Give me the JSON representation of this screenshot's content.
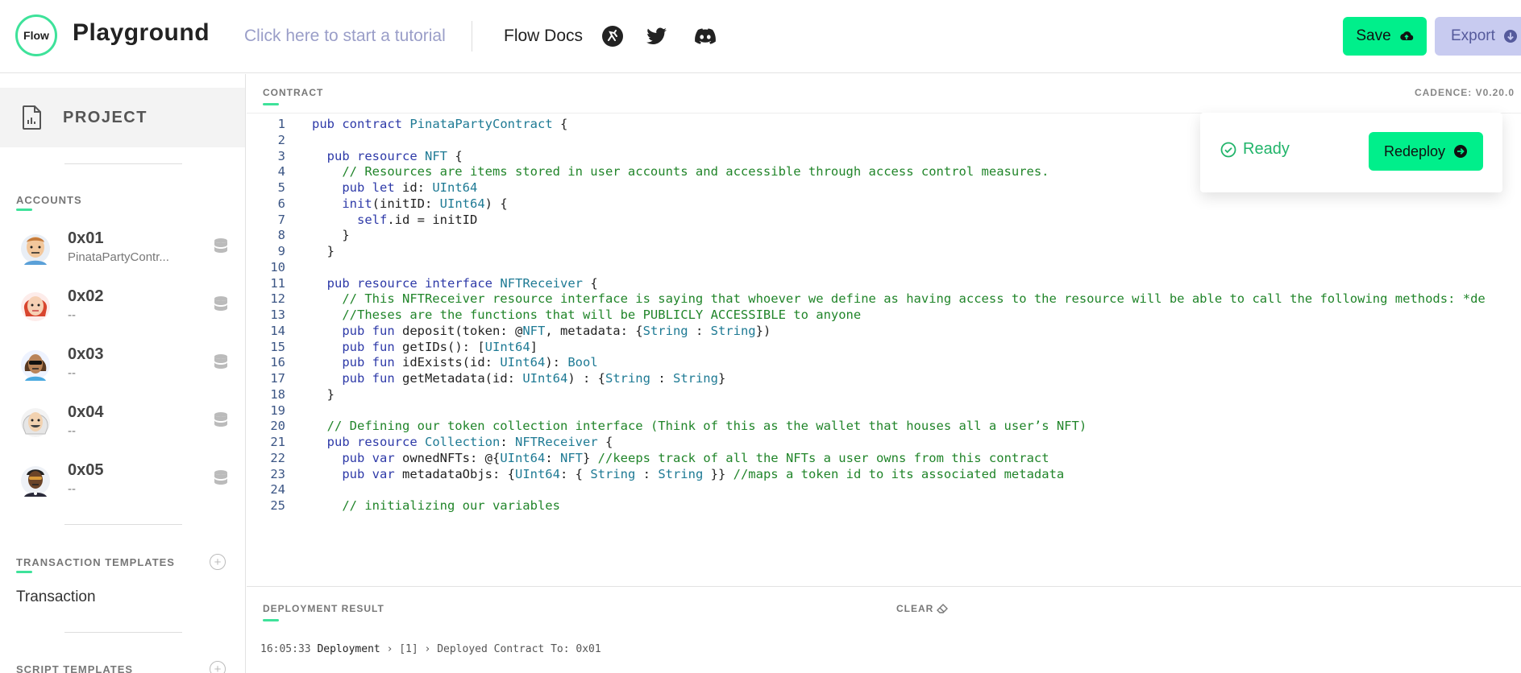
{
  "header": {
    "logo_text": "Flow",
    "title": "Playground",
    "tutorial_link": "Click here to start a tutorial",
    "docs_link": "Flow Docs",
    "icons": [
      "cadence-runner-icon",
      "twitter-icon",
      "discord-icon"
    ],
    "save_label": "Save",
    "export_label": "Export"
  },
  "sidebar": {
    "project_label": "PROJECT",
    "accounts_heading": "ACCOUNTS",
    "accounts": [
      {
        "address": "0x01",
        "subtitle": "PinataPartyContr..."
      },
      {
        "address": "0x02",
        "subtitle": "--"
      },
      {
        "address": "0x03",
        "subtitle": "--"
      },
      {
        "address": "0x04",
        "subtitle": "--"
      },
      {
        "address": "0x05",
        "subtitle": "--"
      }
    ],
    "transaction_heading": "TRANSACTION TEMPLATES",
    "transaction_items": [
      "Transaction"
    ],
    "script_heading": "SCRIPT TEMPLATES"
  },
  "editor": {
    "contract_label": "CONTRACT",
    "cadence_version": "CADENCE: V0.20.0",
    "status": "Ready",
    "redeploy_label": "Redeploy",
    "lines": [
      {
        "n": "1",
        "text": "pub contract PinataPartyContract {"
      },
      {
        "n": "2",
        "text": ""
      },
      {
        "n": "3",
        "text": "  pub resource NFT {"
      },
      {
        "n": "4",
        "text": "    // Resources are items stored in user accounts and accessible through access control measures."
      },
      {
        "n": "5",
        "text": "    pub let id: UInt64"
      },
      {
        "n": "6",
        "text": "    init(initID: UInt64) {"
      },
      {
        "n": "7",
        "text": "      self.id = initID"
      },
      {
        "n": "8",
        "text": "    }"
      },
      {
        "n": "9",
        "text": "  }"
      },
      {
        "n": "10",
        "text": ""
      },
      {
        "n": "11",
        "text": "  pub resource interface NFTReceiver {"
      },
      {
        "n": "12",
        "text": "    // This NFTReceiver resource interface is saying that whoever we define as having access to the resource will be able to call the following methods: *de"
      },
      {
        "n": "13",
        "text": "    //Theses are the functions that will be PUBLICLY ACCESSIBLE to anyone"
      },
      {
        "n": "14",
        "text": "    pub fun deposit(token: @NFT, metadata: {String : String})"
      },
      {
        "n": "15",
        "text": "    pub fun getIDs(): [UInt64]"
      },
      {
        "n": "16",
        "text": "    pub fun idExists(id: UInt64): Bool"
      },
      {
        "n": "17",
        "text": "    pub fun getMetadata(id: UInt64) : {String : String}"
      },
      {
        "n": "18",
        "text": "  }"
      },
      {
        "n": "19",
        "text": ""
      },
      {
        "n": "20",
        "text": "  // Defining our token collection interface (Think of this as the wallet that houses all a user’s NFT)"
      },
      {
        "n": "21",
        "text": "  pub resource Collection: NFTReceiver {"
      },
      {
        "n": "22",
        "text": "    pub var ownedNFTs: @{UInt64: NFT} //keeps track of all the NFTs a user owns from this contract"
      },
      {
        "n": "23",
        "text": "    pub var metadataObjs: {UInt64: { String : String }} //maps a token id to its associated metadata"
      },
      {
        "n": "24",
        "text": ""
      },
      {
        "n": "25",
        "text": "    // initializing our variables"
      }
    ]
  },
  "result": {
    "label": "DEPLOYMENT RESULT",
    "clear_label": "CLEAR",
    "log_time": "16:05:33",
    "log_type": "Deployment",
    "log_index": "[1]",
    "log_message": "Deployed Contract To: 0x01"
  },
  "colors": {
    "accent_green": "#00ef8b",
    "export_bg": "#c8cbf0",
    "tutorial_text": "#9a9ec8",
    "ready_green": "#21b46a"
  }
}
